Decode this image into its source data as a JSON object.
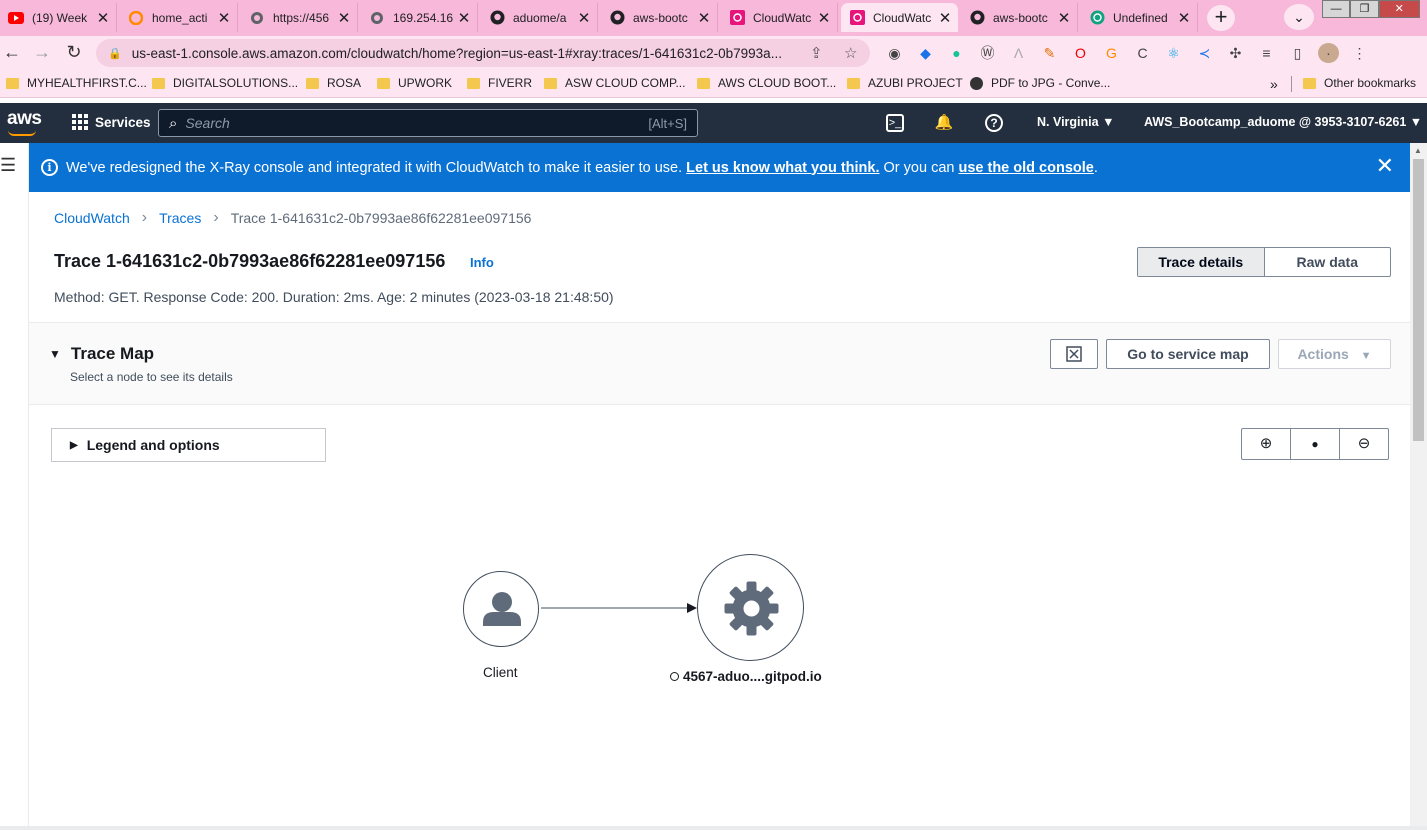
{
  "browser": {
    "tabs": [
      {
        "title": "(19) Week",
        "icon": "youtube-icon",
        "color": "#ff0000"
      },
      {
        "title": "home_acti",
        "icon": "gitpod-icon",
        "color": "#ff8a00"
      },
      {
        "title": "https://456",
        "icon": "globe-icon",
        "color": "#5f6368"
      },
      {
        "title": "169.254.16",
        "icon": "globe-icon",
        "color": "#5f6368"
      },
      {
        "title": "aduome/a",
        "icon": "github-icon",
        "color": "#202124"
      },
      {
        "title": "aws-bootc",
        "icon": "github-icon",
        "color": "#202124"
      },
      {
        "title": "CloudWatc",
        "icon": "cloudwatch-icon",
        "color": "#e7157b"
      },
      {
        "title": "CloudWatc",
        "icon": "cloudwatch-icon",
        "color": "#e7157b"
      },
      {
        "title": "aws-bootc",
        "icon": "github-icon",
        "color": "#202124"
      },
      {
        "title": "Undefined",
        "icon": "chatgpt-icon",
        "color": "#10a37f"
      }
    ],
    "url": "us-east-1.console.aws.amazon.com/cloudwatch/home?region=us-east-1#xray:traces/1-641631c2-0b7993a...",
    "bookmarks": [
      {
        "label": "MYHEALTHFIRST.C..."
      },
      {
        "label": "DIGITALSOLUTIONS..."
      },
      {
        "label": "ROSA"
      },
      {
        "label": "UPWORK"
      },
      {
        "label": "FIVERR"
      },
      {
        "label": "ASW CLOUD COMP..."
      },
      {
        "label": "AWS CLOUD BOOT..."
      },
      {
        "label": "AZUBI PROJECT"
      },
      {
        "label": "PDF to JPG - Conve..."
      }
    ],
    "more_bookmarks": "»",
    "other_bookmarks": "Other bookmarks"
  },
  "aws": {
    "logo": "aws",
    "services": "Services",
    "search_placeholder": "Search",
    "search_shortcut": "[Alt+S]",
    "region": "N. Virginia ▼",
    "account": "AWS_Bootcamp_aduome @ 3953-3107-6261 ▼"
  },
  "banner": {
    "text": "We've redesigned the X-Ray console and integrated it with CloudWatch to make it easier to use.",
    "link1": "Let us know what you think.",
    "middle": "Or you can",
    "link2": "use the old console",
    "end": "."
  },
  "breadcrumb": {
    "items": [
      "CloudWatch",
      "Traces",
      "Trace 1-641631c2-0b7993ae86f62281ee097156"
    ]
  },
  "page": {
    "title": "Trace 1-641631c2-0b7993ae86f62281ee097156",
    "info": "Info",
    "meta": "Method: GET. Response Code: 200. Duration: 2ms. Age: 2 minutes (2023-03-18 21:48:50)",
    "tabs": [
      "Trace details",
      "Raw data"
    ]
  },
  "trace_map": {
    "title": "Trace Map",
    "subtitle": "Select a node to see its details",
    "goto_service_map": "Go to service map",
    "actions": "Actions",
    "legend": "Legend and options",
    "nodes": [
      {
        "label": "Client",
        "icon": "user-icon"
      },
      {
        "label": "4567-aduo....gitpod.io",
        "icon": "gear-icon"
      }
    ]
  }
}
